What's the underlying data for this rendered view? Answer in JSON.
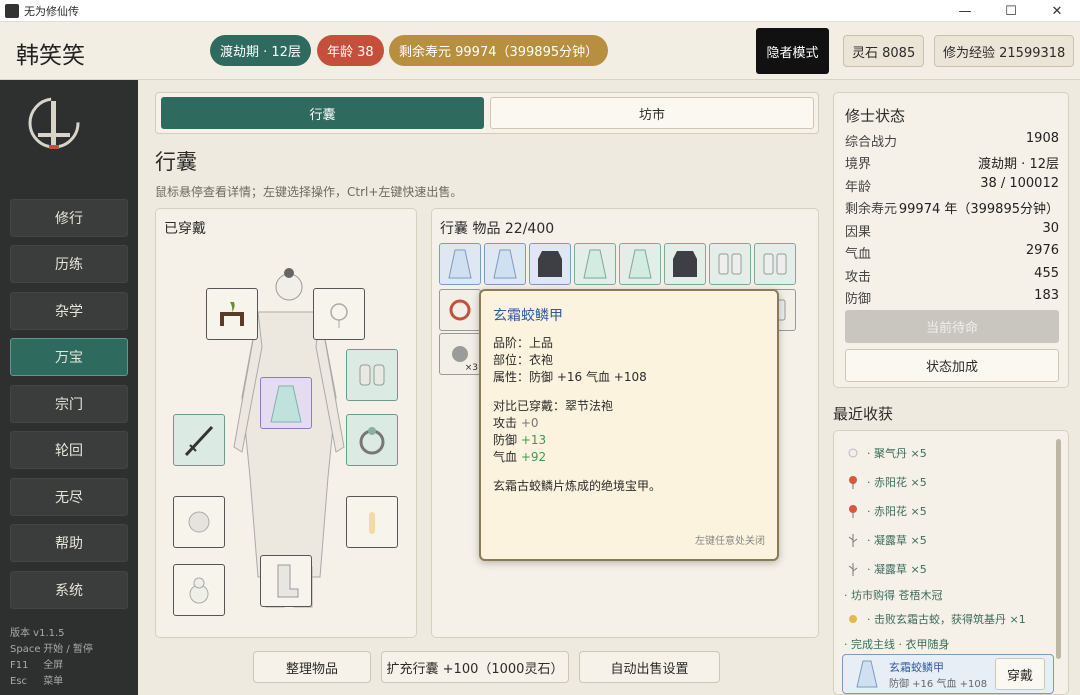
{
  "window": {
    "title": "无为修仙传"
  },
  "header": {
    "player_name": "韩笑笑",
    "realm": "渡劫期 · 12层",
    "age": "年龄 38",
    "lifespan": "剩余寿元 99974（399895分钟）",
    "hermit_mode": "隐者模式",
    "spirit_stone": "灵石  8085",
    "cultivation_exp": "修为经验  21599318"
  },
  "sidebar": {
    "items": [
      "修行",
      "历练",
      "杂学",
      "万宝",
      "宗门",
      "轮回",
      "无尽",
      "帮助",
      "系统"
    ],
    "active": "万宝",
    "version": "版本 v1.1.5",
    "shortcuts": [
      {
        "key": "Space",
        "desc": "开始 / 暂停"
      },
      {
        "key": "F11",
        "desc": "全屏"
      },
      {
        "key": "Esc",
        "desc": "菜单"
      }
    ]
  },
  "tabs": {
    "bag": "行囊",
    "market": "坊市"
  },
  "page": {
    "title": "行囊",
    "hint": "鼠标悬停查看详情；左键选择操作，Ctrl+左键快速出售。"
  },
  "equipment": {
    "title": "已穿戴"
  },
  "bag": {
    "title": "行囊    物品 22/400",
    "ring_qty": "×3"
  },
  "tooltip": {
    "name": "玄霜蛟鳞甲",
    "grade": "品阶：上品",
    "slot": "部位：衣袍",
    "attr_label": "属性：防御 +16    气血 +108",
    "compare_label": "对比已穿戴：翠节法袍",
    "cmp_atk_label": "攻击 ",
    "cmp_atk": "+0",
    "cmp_def_label": "防御 ",
    "cmp_def": "+13",
    "cmp_hp_label": "气血 ",
    "cmp_hp": "+92",
    "desc": "玄霜古蛟鳞片炼成的绝境宝甲。",
    "close_hint": "左键任意处关闭"
  },
  "buttons": {
    "sort": "整理物品",
    "expand": "扩充行囊 +100（1000灵石）",
    "auto_sell": "自动出售设置"
  },
  "status": {
    "title": "修士状态",
    "rows": [
      {
        "label": "综合战力",
        "value": "1908"
      },
      {
        "label": "境界",
        "value": "渡劫期 · 12层"
      },
      {
        "label": "年龄",
        "value": "38 / 100012"
      },
      {
        "label": "剩余寿元",
        "value": "99974 年（399895分钟）"
      },
      {
        "label": "因果",
        "value": "30"
      },
      {
        "label": "气血",
        "value": "2976"
      },
      {
        "label": "攻击",
        "value": "455"
      },
      {
        "label": "防御",
        "value": "183"
      }
    ],
    "disabled_button": "当前待命",
    "bonus_button": "状态加成"
  },
  "recent": {
    "title": "最近收获",
    "items": [
      "· 聚气丹 ×5",
      "· 赤阳花 ×5",
      "· 赤阳花 ×5",
      "· 凝露草 ×5",
      "· 凝露草 ×5"
    ],
    "market_buy": "· 坊市购得 苍梧木冠",
    "defeat": "· 击败玄霜古蛟，获得筑基丹 ×1",
    "mainline": "· 完成主线 · 衣甲随身",
    "card_name": "玄霜蛟鳞甲",
    "card_sub": "防御 +16    气血 +108",
    "wear_button": "穿戴"
  }
}
